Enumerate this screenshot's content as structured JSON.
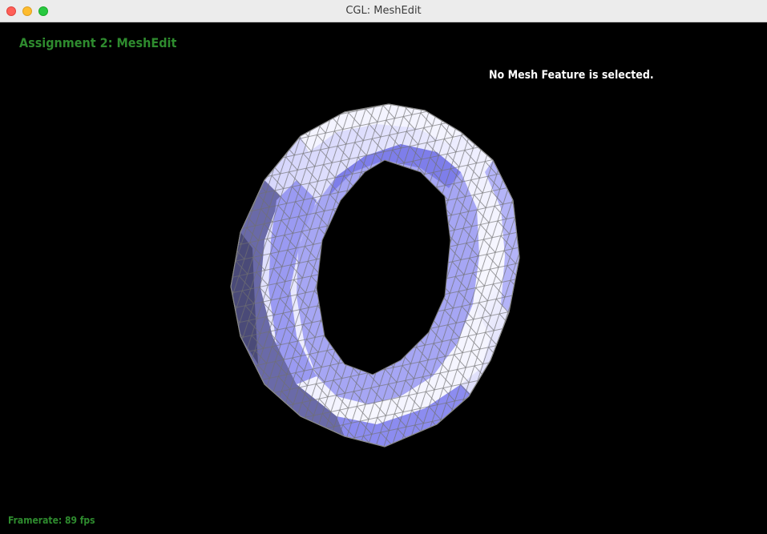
{
  "window": {
    "title": "CGL: MeshEdit"
  },
  "overlay": {
    "assignment_title": "Assignment 2: MeshEdit",
    "selection_status": "No Mesh Feature is selected.",
    "framerate": "Framerate: 89 fps"
  },
  "colors": {
    "title_text": "#2e8b2e",
    "status_text": "#ffffff",
    "background": "#000000",
    "mesh_fill_light": "#f2f2ff",
    "mesh_fill_mid": "#b8b8f6",
    "mesh_fill_blue": "#8c8cf0",
    "mesh_fill_dark": "#4a4a78",
    "mesh_wire": "#6f6f6f"
  }
}
